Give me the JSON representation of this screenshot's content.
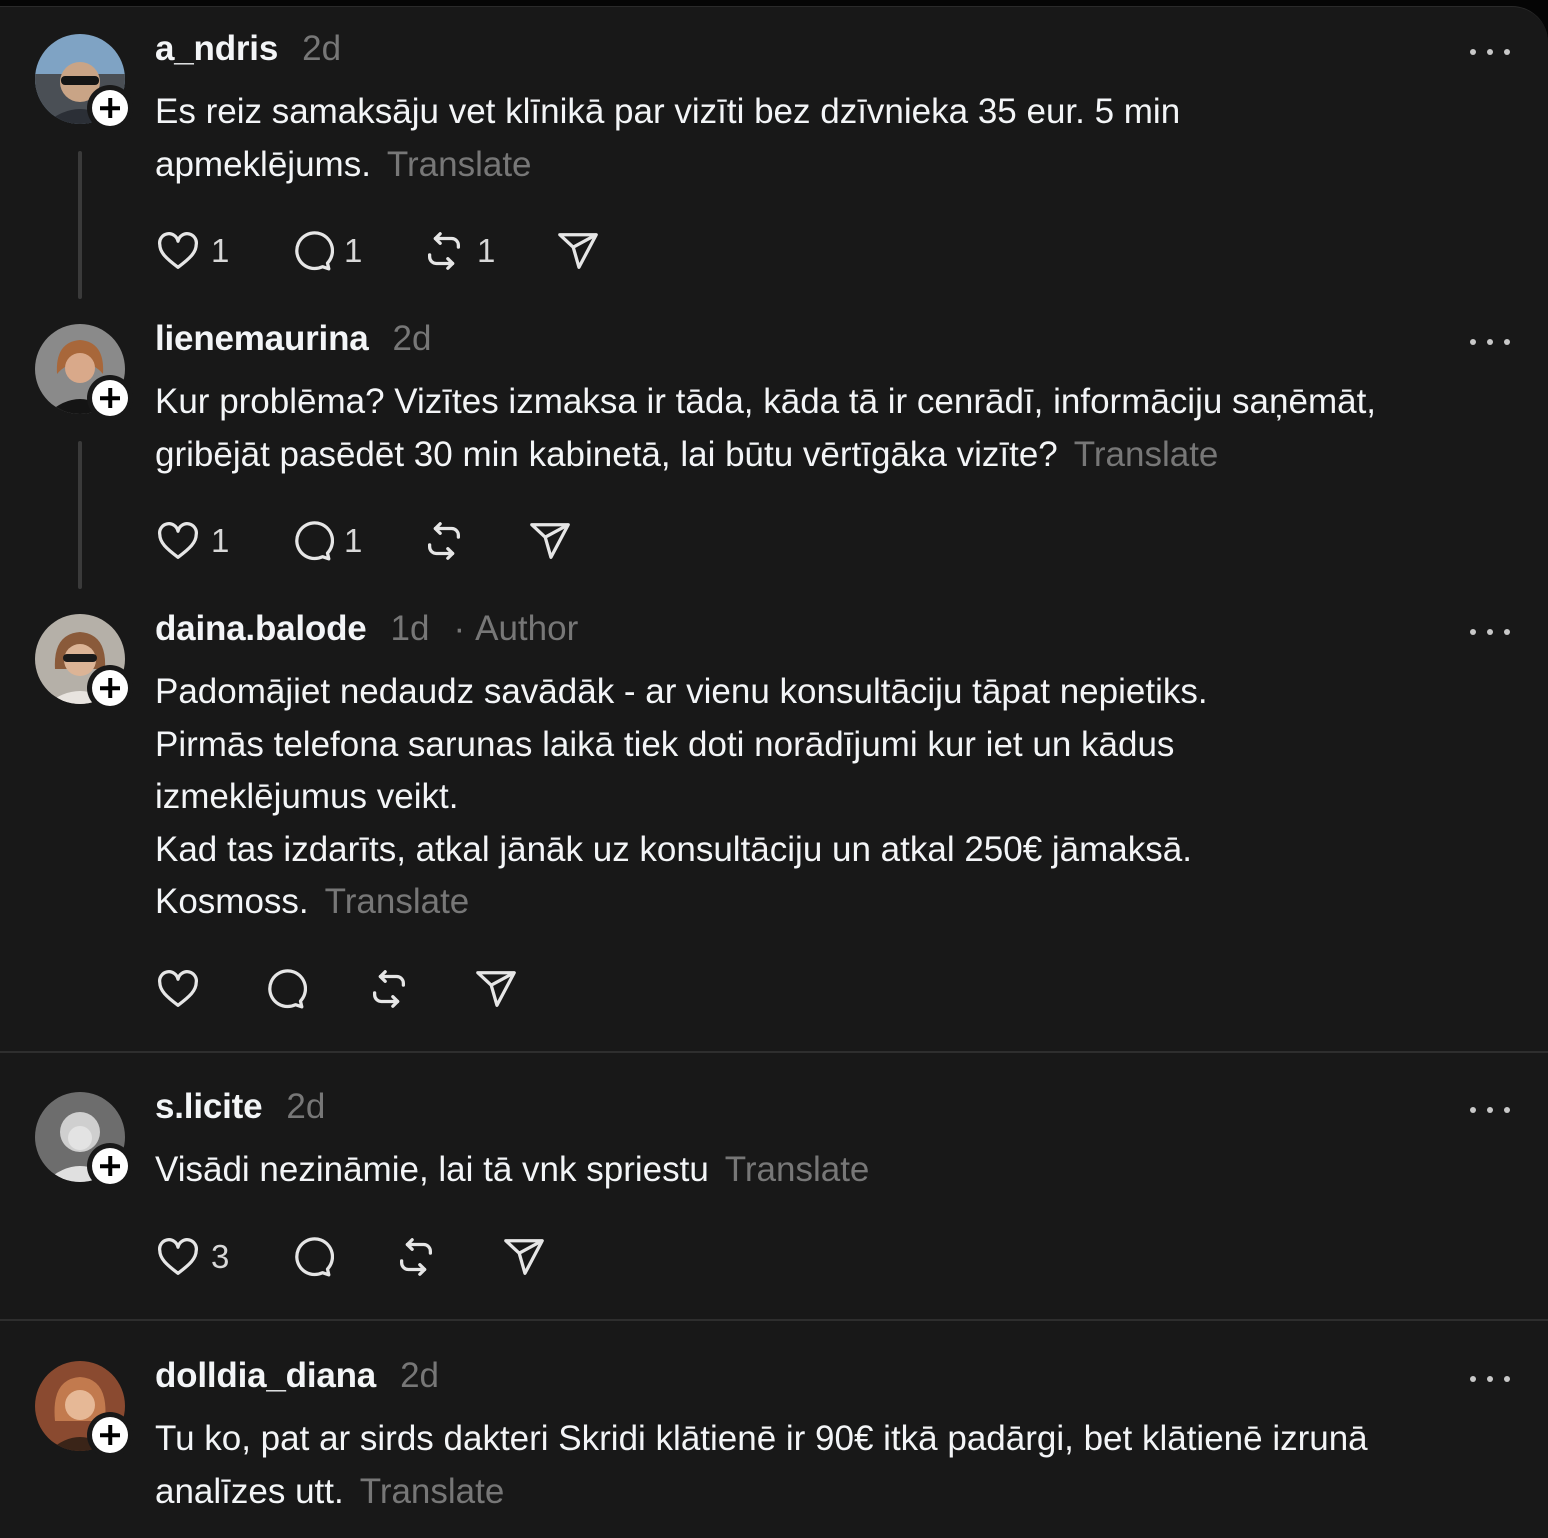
{
  "posts": [
    {
      "username": "a_ndris",
      "time": "2d",
      "lines": [
        "Es reiz samaksāju vet klīnikā par vizīti bez dzīvnieka 35 eur. 5 min",
        "apmeklējums."
      ],
      "translate": "Translate",
      "likes": "1",
      "replies": "1",
      "reposts": "1"
    },
    {
      "username": "lienemaurina",
      "time": "2d",
      "lines": [
        "Kur problēma? Vizītes izmaksa ir tāda, kāda tā ir cenrādī, informāciju saņēmāt,",
        "gribējāt pasēdēt 30 min kabinetā, lai būtu vērtīgāka vizīte?"
      ],
      "translate": "Translate",
      "likes": "1",
      "replies": "1"
    },
    {
      "username": "daina.balode",
      "time": "1d",
      "author_label": "Author",
      "author_dot": "·",
      "lines": [
        "Padomājiet nedaudz savādāk - ar vienu konsultāciju tāpat nepietiks.",
        "Pirmās telefona sarunas laikā tiek doti norādījumi kur iet un kādus",
        "izmeklējumus veikt.",
        "Kad tas izdarīts, atkal jānāk uz konsultāciju un atkal 250€ jāmaksā.",
        "Kosmoss."
      ],
      "translate": "Translate"
    },
    {
      "username": "s.licite",
      "time": "2d",
      "lines": [
        "Visādi nezināmie, lai tā vnk spriestu"
      ],
      "translate": "Translate",
      "likes": "3"
    },
    {
      "username": "dolldia_diana",
      "time": "2d",
      "lines": [
        "Tu ko, pat ar sirds dakteri Skridi klātienē ir 90€ itkā padārgi, bet klātienē izrunā",
        "analīzes utt."
      ],
      "translate": "Translate"
    }
  ],
  "icons": {
    "like": "heart-icon",
    "reply": "comment-icon",
    "repost": "repost-icon",
    "share": "send-icon",
    "more": "more-icon",
    "follow": "plus-icon"
  },
  "colors": {
    "background": "#181818",
    "text": "#f3f5f7",
    "secondary": "#777777"
  }
}
